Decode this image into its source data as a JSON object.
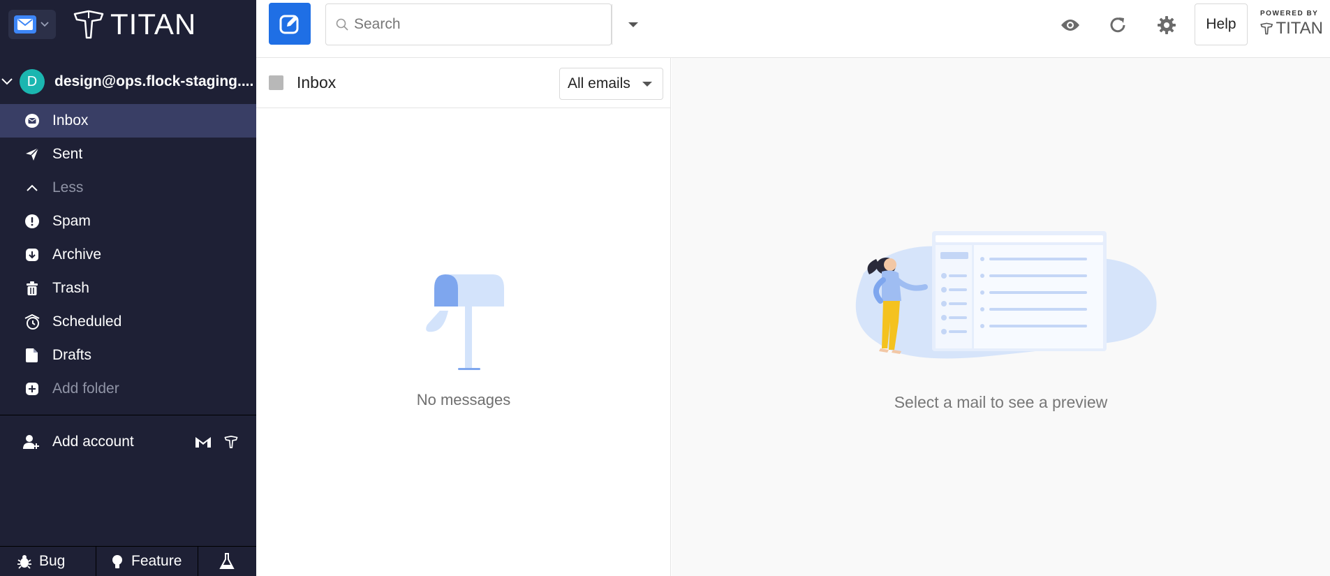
{
  "app": {
    "brand": "TITAN"
  },
  "sidebar": {
    "account_initial": "D",
    "account_email": "design@ops.flock-staging....",
    "folders": [
      {
        "label": "Inbox",
        "icon": "inbox-icon",
        "active": true
      },
      {
        "label": "Sent",
        "icon": "send-icon"
      },
      {
        "label": "Less",
        "icon": "chevron-up-icon",
        "muted": true
      },
      {
        "label": "Spam",
        "icon": "spam-icon"
      },
      {
        "label": "Archive",
        "icon": "archive-icon"
      },
      {
        "label": "Trash",
        "icon": "trash-icon"
      },
      {
        "label": "Scheduled",
        "icon": "scheduled-icon"
      },
      {
        "label": "Drafts",
        "icon": "drafts-icon"
      },
      {
        "label": "Add folder",
        "icon": "add-folder-icon",
        "muted": true
      }
    ],
    "add_account_label": "Add account",
    "bottom": {
      "bug_label": "Bug",
      "feature_label": "Feature"
    }
  },
  "topbar": {
    "search_placeholder": "Search",
    "help_label": "Help",
    "powered_by_label": "POWERED BY",
    "powered_by_brand": "TITAN"
  },
  "list": {
    "title": "Inbox",
    "filter_selected": "All emails",
    "empty_text": "No messages"
  },
  "preview": {
    "empty_text": "Select a mail to see a preview"
  },
  "colors": {
    "sidebar_bg": "#1e2035",
    "sidebar_active": "#393e65",
    "accent": "#1f6fe5",
    "avatar": "#1bb6b0"
  }
}
